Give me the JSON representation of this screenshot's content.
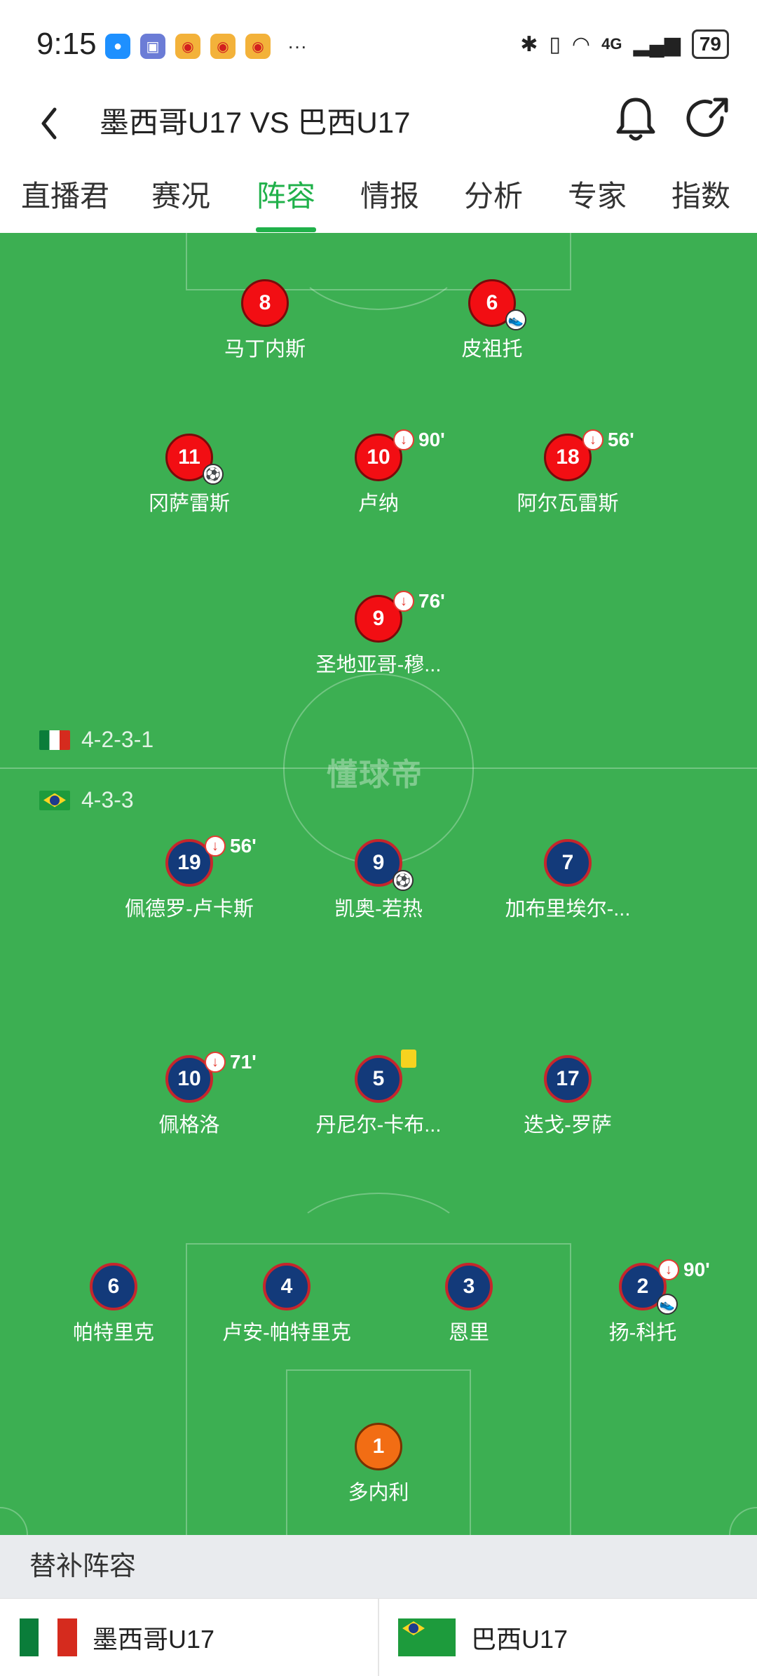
{
  "status_bar": {
    "time": "9:15",
    "battery": "79",
    "network": "4G",
    "more": "···"
  },
  "header": {
    "title": "墨西哥U17 VS 巴西U17"
  },
  "tabs": [
    "直播君",
    "赛况",
    "阵容",
    "情报",
    "分析",
    "专家",
    "指数"
  ],
  "active_tab": "阵容",
  "watermark": "懂球帝",
  "formations": {
    "home": "4-2-3-1",
    "away": "4-3-3"
  },
  "home_players": [
    {
      "num": "8",
      "name": "马丁内斯"
    },
    {
      "num": "6",
      "name": "皮祖托"
    },
    {
      "num": "11",
      "name": "冈萨雷斯"
    },
    {
      "num": "10",
      "name": "卢纳",
      "sub_minute": "90'"
    },
    {
      "num": "18",
      "name": "阿尔瓦雷斯",
      "sub_minute": "56'"
    },
    {
      "num": "9",
      "name": "圣地亚哥-穆...",
      "sub_minute": "76'"
    }
  ],
  "away_players": [
    {
      "num": "19",
      "name": "佩德罗-卢卡斯",
      "sub_minute": "56'"
    },
    {
      "num": "9",
      "name": "凯奥-若热"
    },
    {
      "num": "7",
      "name": "加布里埃尔-..."
    },
    {
      "num": "10",
      "name": "佩格洛",
      "sub_minute": "71'"
    },
    {
      "num": "5",
      "name": "丹尼尔-卡布..."
    },
    {
      "num": "17",
      "name": "迭戈-罗萨"
    },
    {
      "num": "6",
      "name": "帕特里克"
    },
    {
      "num": "4",
      "name": "卢安-帕特里克"
    },
    {
      "num": "3",
      "name": "恩里"
    },
    {
      "num": "2",
      "name": "扬-科托",
      "sub_minute": "90'"
    },
    {
      "num": "1",
      "name": "多内利"
    }
  ],
  "subs": {
    "title": "替补阵容",
    "home_team": "墨西哥U17",
    "away_team": "巴西U17"
  }
}
